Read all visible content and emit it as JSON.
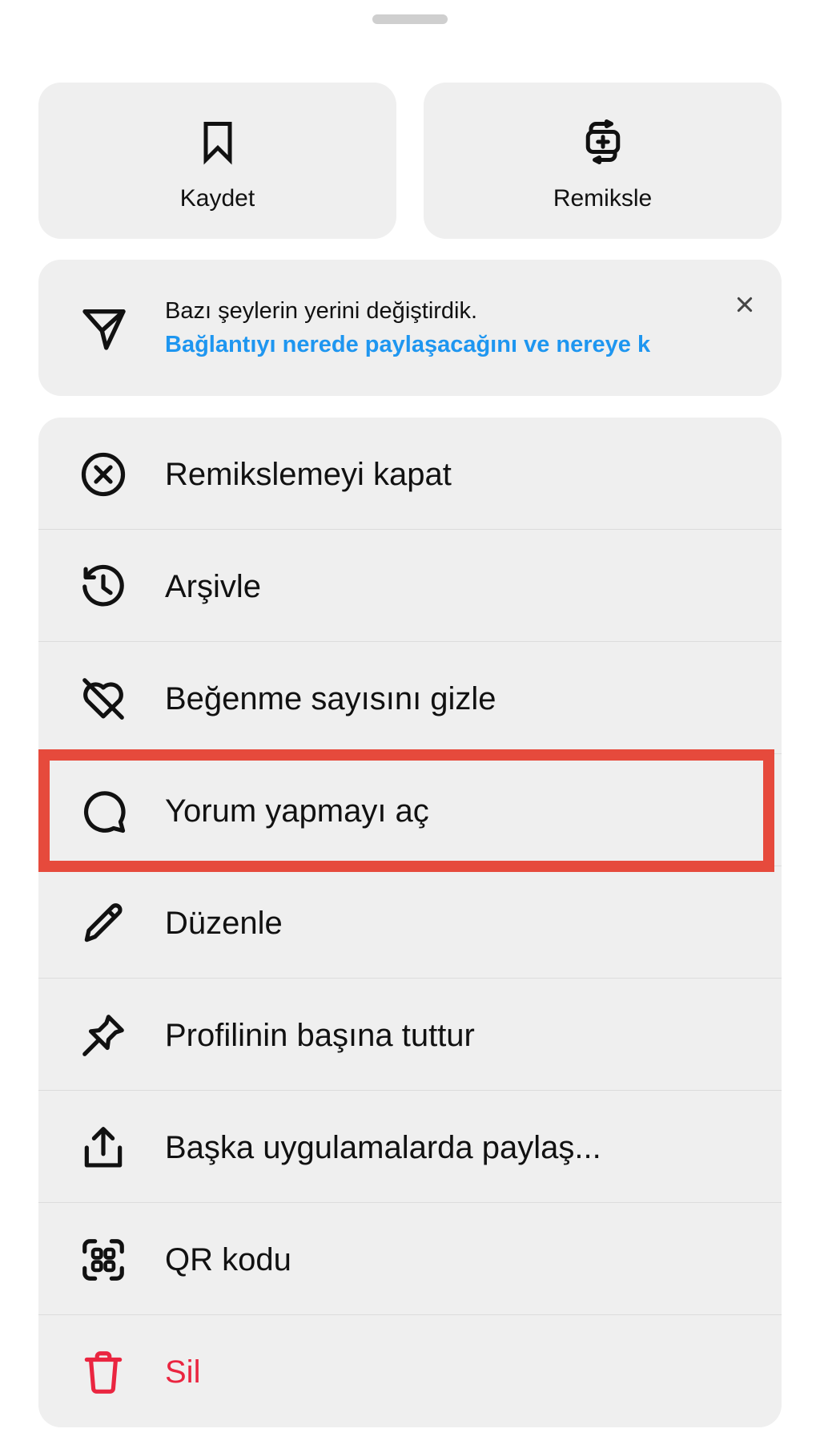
{
  "top_actions": {
    "save": {
      "label": "Kaydet",
      "icon": "bookmark-icon"
    },
    "remix": {
      "label": "Remiksle",
      "icon": "remix-icon"
    }
  },
  "notice": {
    "title": "Bazı şeylerin yerini değiştirdik.",
    "link": "Bağlantıyı nerede paylaşacağını ve nereye k",
    "icon": "send-icon",
    "close_icon": "close-icon"
  },
  "menu": {
    "items": [
      {
        "label": "Remikslemeyi kapat",
        "icon": "circle-x-icon"
      },
      {
        "label": "Arşivle",
        "icon": "archive-history-icon"
      },
      {
        "label": "Beğenme sayısını gizle",
        "icon": "heart-off-icon"
      },
      {
        "label": "Yorum yapmayı aç",
        "icon": "comment-icon"
      },
      {
        "label": "Düzenle",
        "icon": "pencil-icon"
      },
      {
        "label": "Profilinin başına tuttur",
        "icon": "pin-icon"
      },
      {
        "label": "Başka uygulamalarda paylaş...",
        "icon": "share-icon"
      },
      {
        "label": "QR kodu",
        "icon": "qr-code-icon"
      },
      {
        "label": "Sil",
        "icon": "trash-icon"
      }
    ]
  },
  "colors": {
    "sheet_card": "#efefef",
    "link": "#1e96f0",
    "danger": "#ea2540",
    "highlight": "#e64a3c"
  }
}
